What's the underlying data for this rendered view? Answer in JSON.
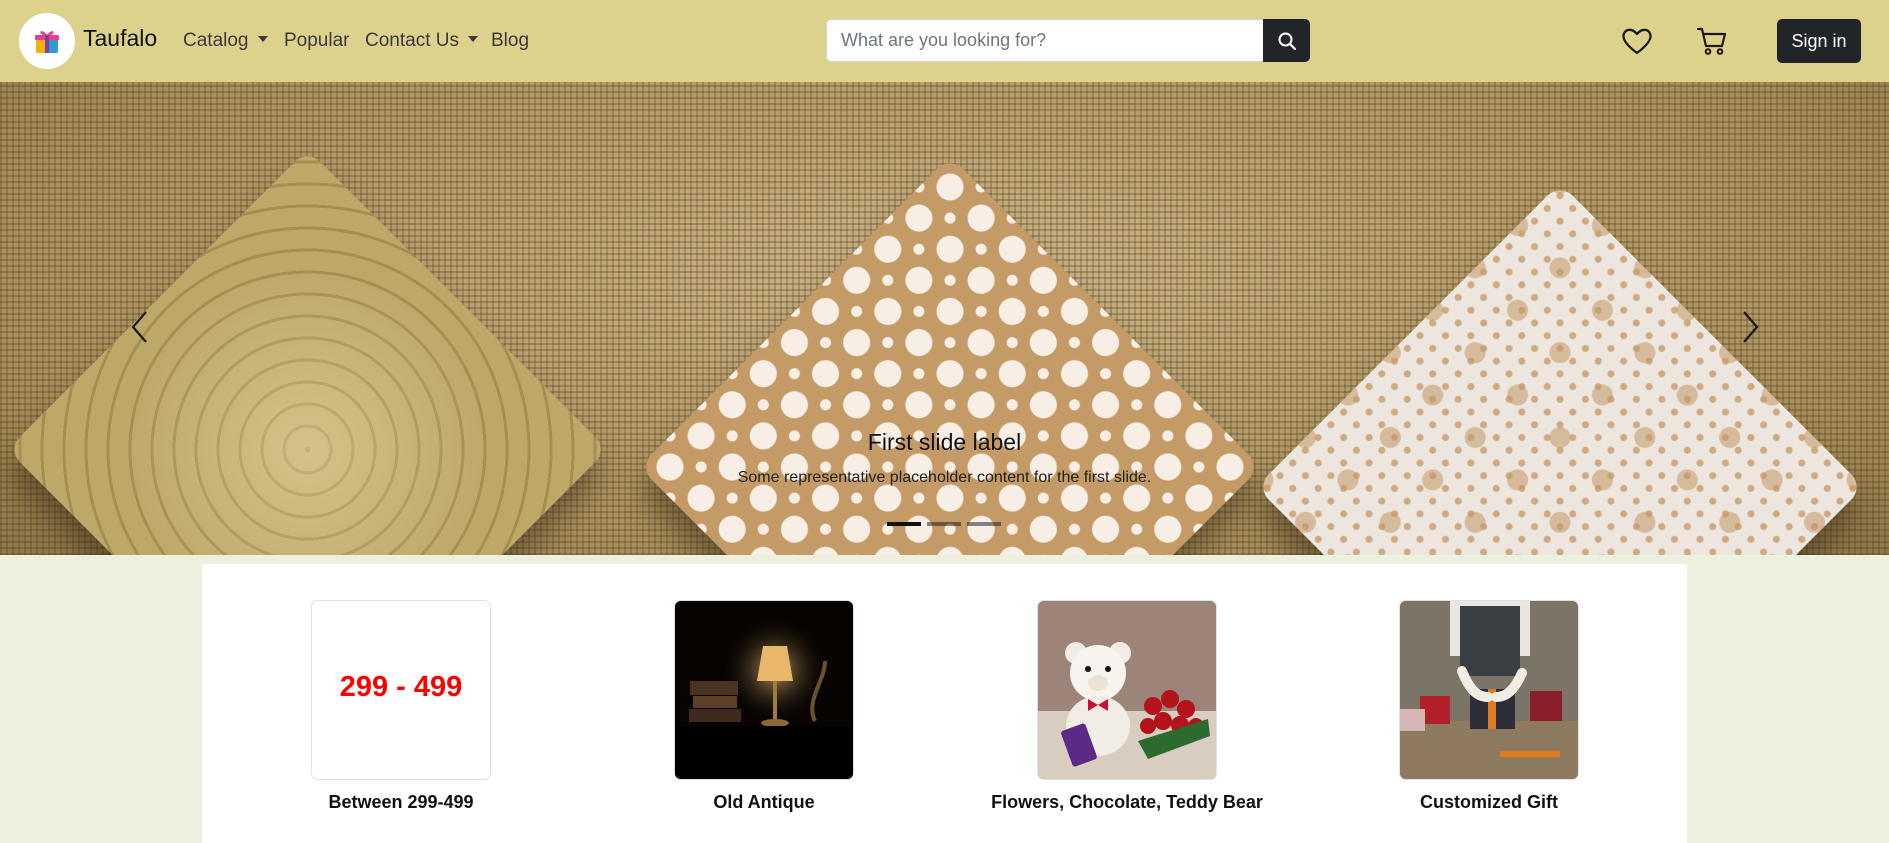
{
  "brand": {
    "name": "Taufalo",
    "logo_icon": "gift-icon"
  },
  "nav": {
    "links": [
      {
        "label": "Catalog",
        "dropdown": true
      },
      {
        "label": "Popular",
        "dropdown": false
      },
      {
        "label": "Contact Us",
        "dropdown": true
      },
      {
        "label": "Blog",
        "dropdown": false
      }
    ]
  },
  "search": {
    "placeholder": "What are you looking for?",
    "value": "",
    "button_icon": "search-icon"
  },
  "actions": {
    "wishlist_icon": "heart-icon",
    "cart_icon": "cart-icon",
    "signin_label": "Sign in"
  },
  "carousel": {
    "caption_title": "First slide label",
    "caption_text": "Some representative placeholder content for the first slide.",
    "prev_icon": "chevron-left-icon",
    "next_icon": "chevron-right-icon",
    "slide_count": 3,
    "active_index": 0
  },
  "categories": [
    {
      "label": "Between 299-499",
      "thumb_text": "299 - 499"
    },
    {
      "label": "Old Antique"
    },
    {
      "label": "Flowers, Chocolate, Teddy Bear"
    },
    {
      "label": "Customized Gift"
    }
  ],
  "colors": {
    "navbar_bg": "#ddd28c",
    "page_bg": "#eef0df",
    "dark": "#212529",
    "price_red": "#ff0000"
  }
}
